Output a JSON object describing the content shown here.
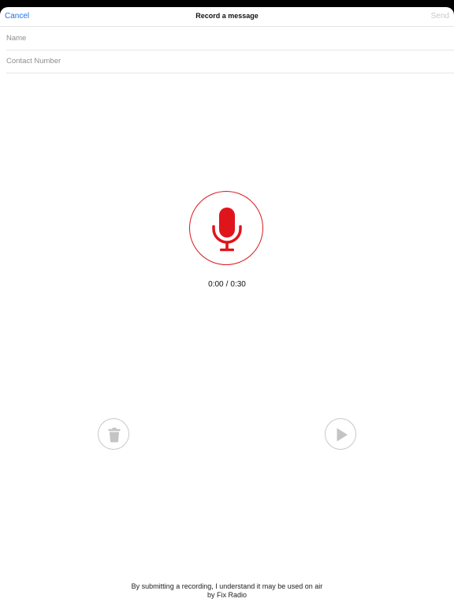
{
  "navbar": {
    "cancel_label": "Cancel",
    "title": "Record a message",
    "send_label": "Send"
  },
  "form": {
    "name_placeholder": "Name",
    "name_value": "",
    "contact_placeholder": "Contact Number",
    "contact_value": ""
  },
  "recorder": {
    "elapsed": "0:00",
    "separator": "/",
    "duration": "0:30",
    "icon": "microphone-icon",
    "accent_color": "#d9191f"
  },
  "controls": {
    "delete_icon": "trash-icon",
    "play_icon": "play-icon",
    "disabled_color": "#c8c8c8"
  },
  "footer": {
    "line1": "By submitting a recording, I understand it may be used on air",
    "line2": "by Fix Radio"
  },
  "colors": {
    "link": "#1a73e8",
    "send_disabled": "#c9c9c9"
  }
}
